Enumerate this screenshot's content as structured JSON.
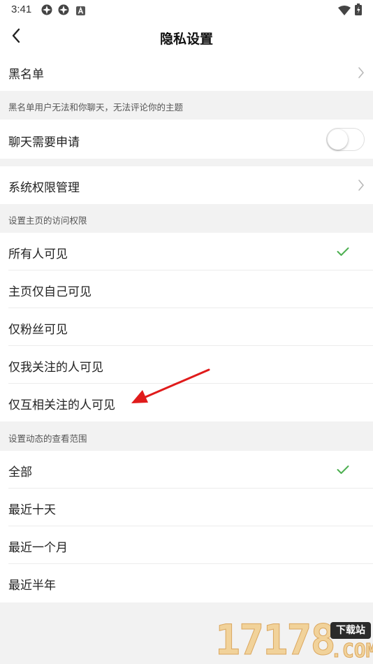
{
  "status_bar": {
    "time": "3:41",
    "left_icons": [
      "aperture-icon",
      "aperture-icon",
      "a-box-icon"
    ],
    "right_icons": [
      "wifi-icon",
      "battery-icon"
    ]
  },
  "header": {
    "title": "隐私设置",
    "back_icon": "chevron-left-icon"
  },
  "blacklist": {
    "label": "黑名单",
    "caption": "黑名单用户无法和你聊天，无法评论你的主题"
  },
  "chat_request": {
    "label": "聊天需要申请",
    "enabled": false
  },
  "system_permissions": {
    "label": "系统权限管理"
  },
  "homepage_visibility": {
    "caption": "设置主页的访问权限",
    "options": [
      {
        "label": "所有人可见",
        "selected": true
      },
      {
        "label": "主页仅自己可见",
        "selected": false
      },
      {
        "label": "仅粉丝可见",
        "selected": false
      },
      {
        "label": "仅我关注的人可见",
        "selected": false
      },
      {
        "label": "仅互相关注的人可见",
        "selected": false
      }
    ]
  },
  "feed_range": {
    "caption": "设置动态的查看范围",
    "options": [
      {
        "label": "全部",
        "selected": true
      },
      {
        "label": "最近十天",
        "selected": false
      },
      {
        "label": "最近一个月",
        "selected": false
      },
      {
        "label": "最近半年",
        "selected": false
      }
    ]
  },
  "watermark": {
    "digits": "17178",
    "badge": "下载站",
    "suffix": ".COM"
  },
  "colors": {
    "check": "#4caf50",
    "arrow": "#e01b1b",
    "background": "#f2f2f2",
    "chevron": "#b8b8b8"
  }
}
